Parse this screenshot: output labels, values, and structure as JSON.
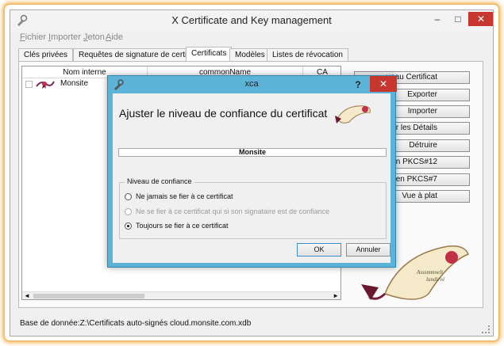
{
  "window": {
    "title": "X Certificate and Key management",
    "min": "–",
    "max": "□",
    "close": "✕"
  },
  "menu": [
    "Fichier",
    "Importer",
    "Jeton",
    "Aide"
  ],
  "tabs": [
    "Clés privées",
    "Requêtes de signature de certificat",
    "Certificats",
    "Modèles",
    "Listes de révocation"
  ],
  "active_tab": "Certificats",
  "list": {
    "columns": [
      "Nom interne",
      "commonName",
      "CA"
    ],
    "rows": [
      {
        "name": "Monsite"
      }
    ],
    "scroll_left": "◄",
    "scroll_right": "►"
  },
  "actions": [
    "Nouveau Certificat",
    "Exporter",
    "Importer",
    "Afficher les Détails",
    "Détruire",
    "Importer en PKCS#12",
    "Importer en PKCS#7",
    "Vue à plat"
  ],
  "actions_visible": [
    "veau Certificat",
    "Exporter",
    "Importer",
    "her les Détails",
    "Détruire",
    "ter en PKCS#12",
    "ter en PKCS#7",
    "Vue à plat"
  ],
  "status": "Base de donnée:Z:\\Certificats auto-signés cloud.monsite.com.xdb",
  "dialog": {
    "title": "xca",
    "help": "?",
    "close": "✕",
    "heading": "Ajuster le niveau de confiance du certificat",
    "cert_name": "Monsite",
    "group_title": "Niveau de confiance",
    "options": [
      {
        "label": "Ne jamais se fier à ce certificat",
        "selected": false,
        "enabled": true
      },
      {
        "label": "Ne se fier à ce certificat qui si son signataire est de confiance",
        "selected": false,
        "enabled": false
      },
      {
        "label": "Toujours se fier à ce certificat",
        "selected": true,
        "enabled": true
      }
    ],
    "ok": "OK",
    "cancel": "Annuler"
  },
  "colors": {
    "dialog_frame": "#5cb3d8",
    "close_red": "#c7372f",
    "glow": "#f3b860"
  }
}
